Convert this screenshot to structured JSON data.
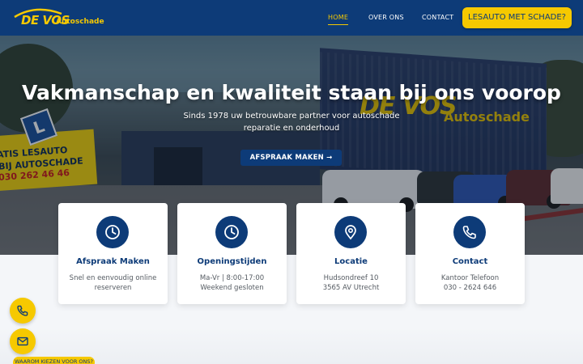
{
  "header": {
    "logo": {
      "brand": "DE VOS",
      "sub": "Autoschade"
    },
    "nav": [
      {
        "label": "HOME",
        "active": true
      },
      {
        "label": "OVER ONS",
        "active": false
      },
      {
        "label": "CONTACT",
        "active": false
      }
    ],
    "cta_label": "LESAUTO MET SCHADE?"
  },
  "hero": {
    "title": "Vakmanschap en kwaliteit staan bij ons voorop",
    "subtitle": "Sinds 1978 uw betrouwbare partner voor autoschade reparatie en onderhoud",
    "button_label": "AFSPRAAK MAKEN →",
    "photo_text": {
      "building_brand": "DE VOS",
      "building_sub": "Autoschade",
      "billboard_line1": "ATIS LESAUTO",
      "billboard_line2": "BIJ AUTOSCHADE",
      "billboard_phone": "030 262 46 46",
      "sign_letter": "L"
    }
  },
  "cards": [
    {
      "icon": "clock-icon",
      "title": "Afspraak Maken",
      "lines": [
        "Snel en eenvoudig online",
        "reserveren"
      ]
    },
    {
      "icon": "clock-icon",
      "title": "Openingstijden",
      "lines": [
        "Ma-Vr | 8:00-17:00",
        "Weekend gesloten"
      ]
    },
    {
      "icon": "location-pin-icon",
      "title": "Locatie",
      "lines": [
        "Hudsondreef 10",
        "3565 AV Utrecht"
      ]
    },
    {
      "icon": "phone-icon",
      "title": "Contact",
      "lines": [
        "Kantoor Telefoon",
        "030 - 2624 646"
      ]
    }
  ],
  "floating": [
    {
      "icon": "phone-icon"
    },
    {
      "icon": "mail-icon"
    }
  ],
  "section_badge": "WAAROM KIEZEN VOOR ONS?",
  "colors": {
    "primary": "#0d3b78",
    "accent": "#f6c900",
    "text_muted": "#555b62"
  }
}
